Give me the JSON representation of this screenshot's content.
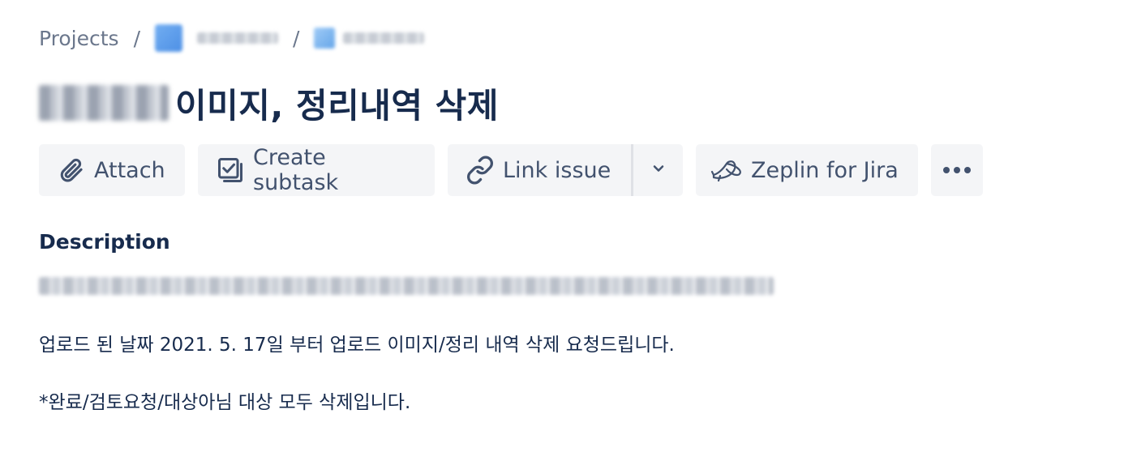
{
  "breadcrumb": {
    "projects_label": "Projects",
    "separator": "/"
  },
  "issue": {
    "title": "이미지, 정리내역 삭제"
  },
  "toolbar": {
    "attach_label": "Attach",
    "create_subtask_label": "Create subtask",
    "link_issue_label": "Link issue",
    "zeplin_label": "Zeplin for Jira"
  },
  "description": {
    "heading": "Description",
    "line1": "업로드 된 날짜 2021. 5. 17일 부터 업로드 이미지/정리 내역 삭제 요청드립니다.",
    "line2": "*완료/검토요청/대상아님 대상 모두 삭제입니다."
  },
  "colors": {
    "text_primary": "#172b4d",
    "text_subtle": "#42526e",
    "button_bg": "#f4f5f7"
  },
  "icons": [
    "paperclip-icon",
    "subtask-icon",
    "link-icon",
    "chevron-down-icon",
    "zeplin-icon",
    "more-icon"
  ]
}
